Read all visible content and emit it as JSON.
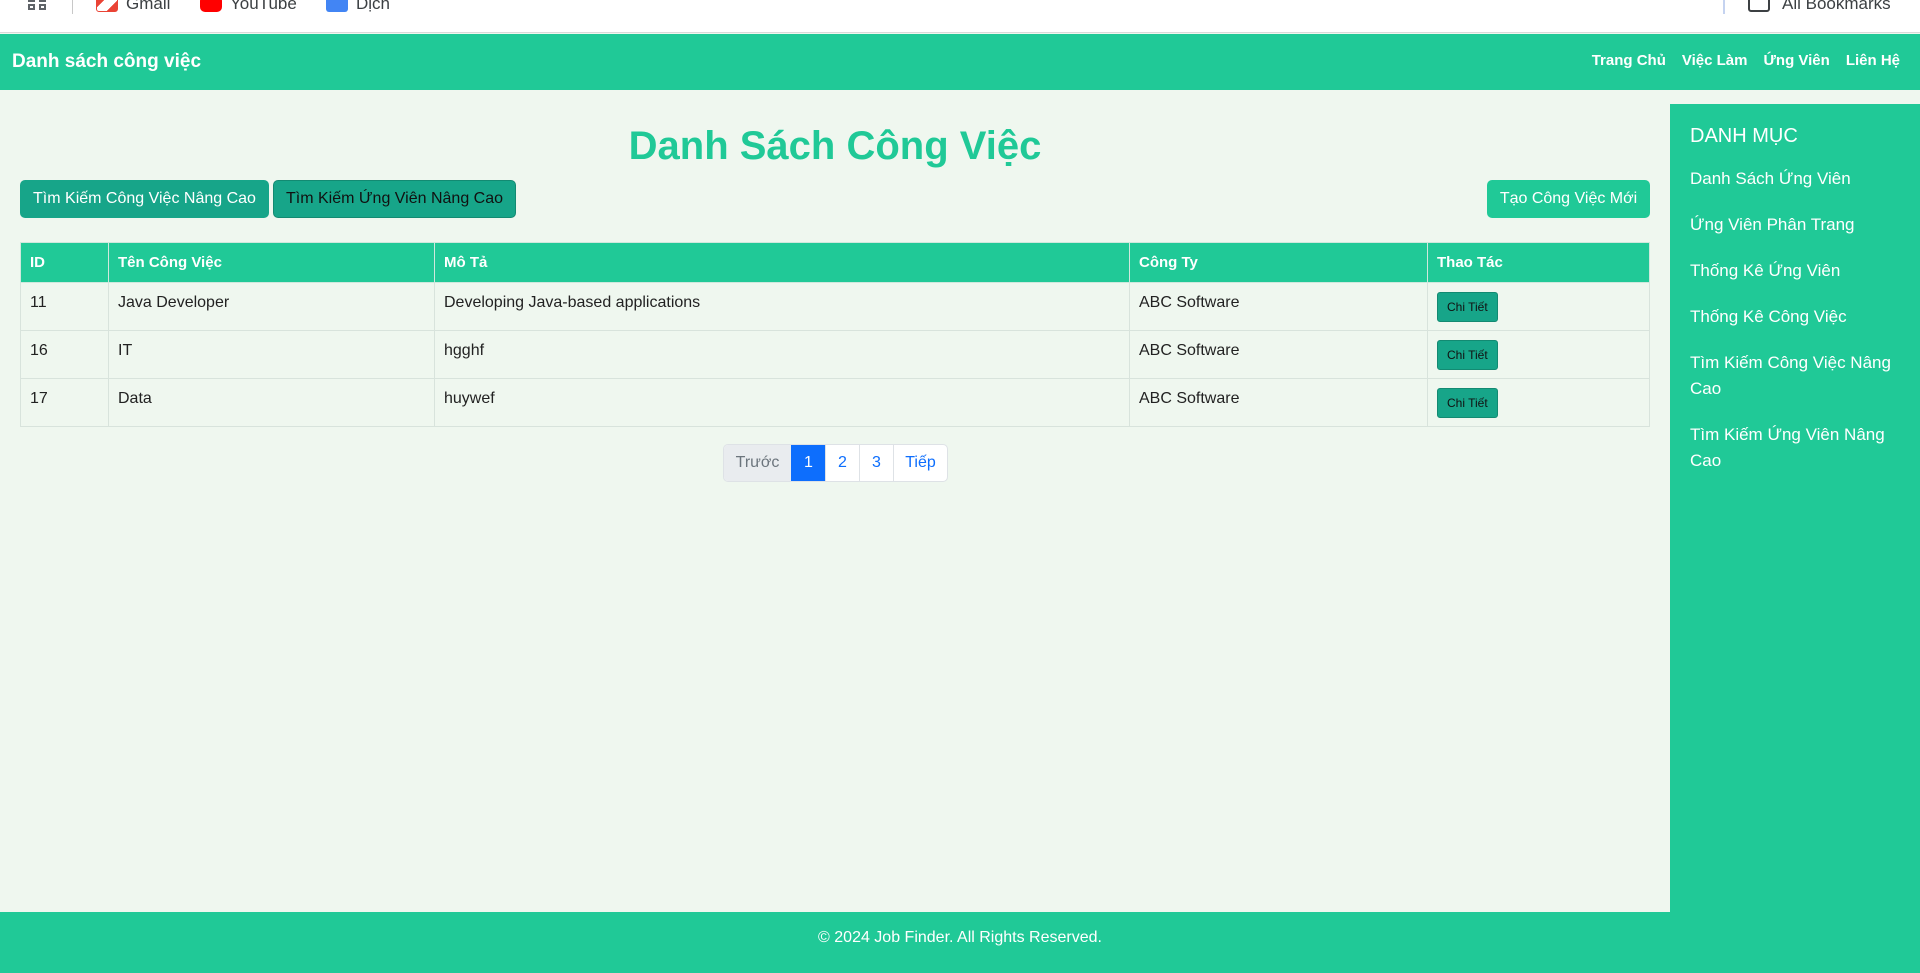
{
  "bookmarks": {
    "items": [
      {
        "label": "Gmail",
        "icon": "gmail-icon"
      },
      {
        "label": "YouTube",
        "icon": "youtube-icon"
      },
      {
        "label": "Dịch",
        "icon": "translate-icon"
      }
    ],
    "all_label": "All Bookmarks"
  },
  "navbar": {
    "brand": "Danh sách công việc",
    "links": [
      "Trang Chủ",
      "Việc Làm",
      "Ứng Viên",
      "Liên Hệ"
    ]
  },
  "main": {
    "title": "Danh Sách Công Việc",
    "buttons": {
      "advanced_job_search": "Tìm Kiếm Công Việc Nâng Cao",
      "advanced_candidate_search": "Tìm Kiếm Ứng Viên Nâng Cao",
      "create_job": "Tạo Công Việc Mới"
    },
    "table": {
      "headers": [
        "ID",
        "Tên Công Việc",
        "Mô Tả",
        "Công Ty",
        "Thao Tác"
      ],
      "rows": [
        {
          "id": "11",
          "name": "Java Developer",
          "description": "Developing Java-based applications",
          "company": "ABC Software",
          "action": "Chi Tiết"
        },
        {
          "id": "16",
          "name": "IT",
          "description": "hgghf",
          "company": "ABC Software",
          "action": "Chi Tiết"
        },
        {
          "id": "17",
          "name": "Data",
          "description": "huywef",
          "company": "ABC Software",
          "action": "Chi Tiết"
        }
      ]
    },
    "pagination": {
      "prev": "Trước",
      "pages": [
        "1",
        "2",
        "3"
      ],
      "current": "1",
      "next": "Tiếp"
    }
  },
  "sidebar": {
    "title": "DANH MỤC",
    "items": [
      "Danh Sách Ứng Viên",
      "Ứng Viên Phân Trang",
      "Thống Kê Ứng Viên",
      "Thống Kê Công Việc",
      "Tìm Kiếm Công Việc Nâng Cao",
      "Tìm Kiếm Ứng Viên Nâng Cao"
    ]
  },
  "footer": {
    "text": "© 2024 Job Finder. All Rights Reserved."
  },
  "colors": {
    "primary": "#20c997",
    "primary_dark": "#17a589",
    "background": "#eff7ef",
    "pagination_active": "#0d6efd"
  }
}
